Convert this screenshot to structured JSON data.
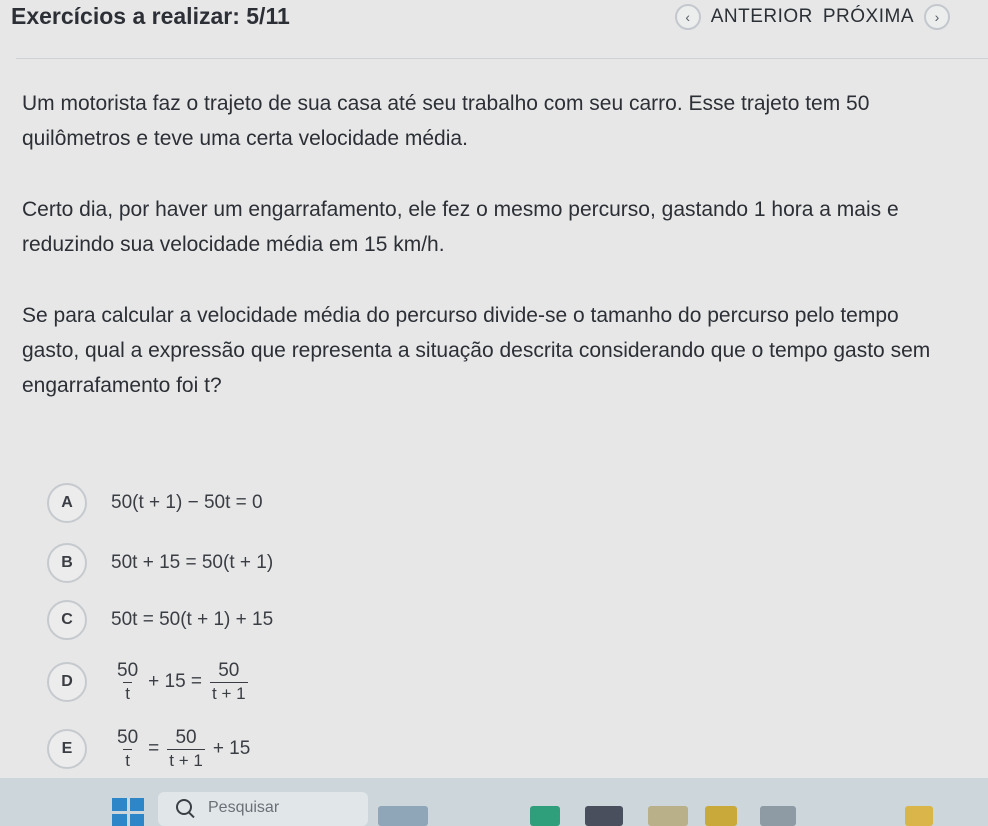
{
  "header": {
    "title": "Exercícios a realizar: 5/11",
    "prev_label": "ANTERIOR",
    "next_label": "PRÓXIMA",
    "prev_icon": "chevron-left-icon",
    "next_icon": "chevron-right-icon"
  },
  "question": {
    "paragraph1": "Um motorista faz o trajeto de sua casa até seu trabalho com seu carro. Esse trajeto tem 50 quilômetros e teve uma certa velocidade média.",
    "paragraph2": "Certo dia, por haver um engarrafamento, ele fez o mesmo percurso, gastando 1 hora a mais e reduzindo sua velocidade média em 15 km/h.",
    "paragraph3": "Se para calcular a velocidade média do percurso divide-se o tamanho do percurso pelo tempo gasto, qual a expressão que representa a situação descrita considerando que o tempo gasto sem engarrafamento foi t?"
  },
  "options": [
    {
      "letter": "A",
      "expr": "50(t + 1) − 50t = 0"
    },
    {
      "letter": "B",
      "expr": "50t + 15 = 50(t + 1)"
    },
    {
      "letter": "C",
      "expr": "50t = 50(t + 1) + 15"
    },
    {
      "letter": "D",
      "frac1_num": "50",
      "frac1_den": "t",
      "mid": "+ 15 =",
      "frac2_num": "50",
      "frac2_den": "t + 1",
      "tail": ""
    },
    {
      "letter": "E",
      "frac1_num": "50",
      "frac1_den": "t",
      "mid": "=",
      "frac2_num": "50",
      "frac2_den": "t + 1",
      "tail": "+ 15"
    }
  ],
  "taskbar": {
    "search_placeholder": "Pesquisar"
  }
}
